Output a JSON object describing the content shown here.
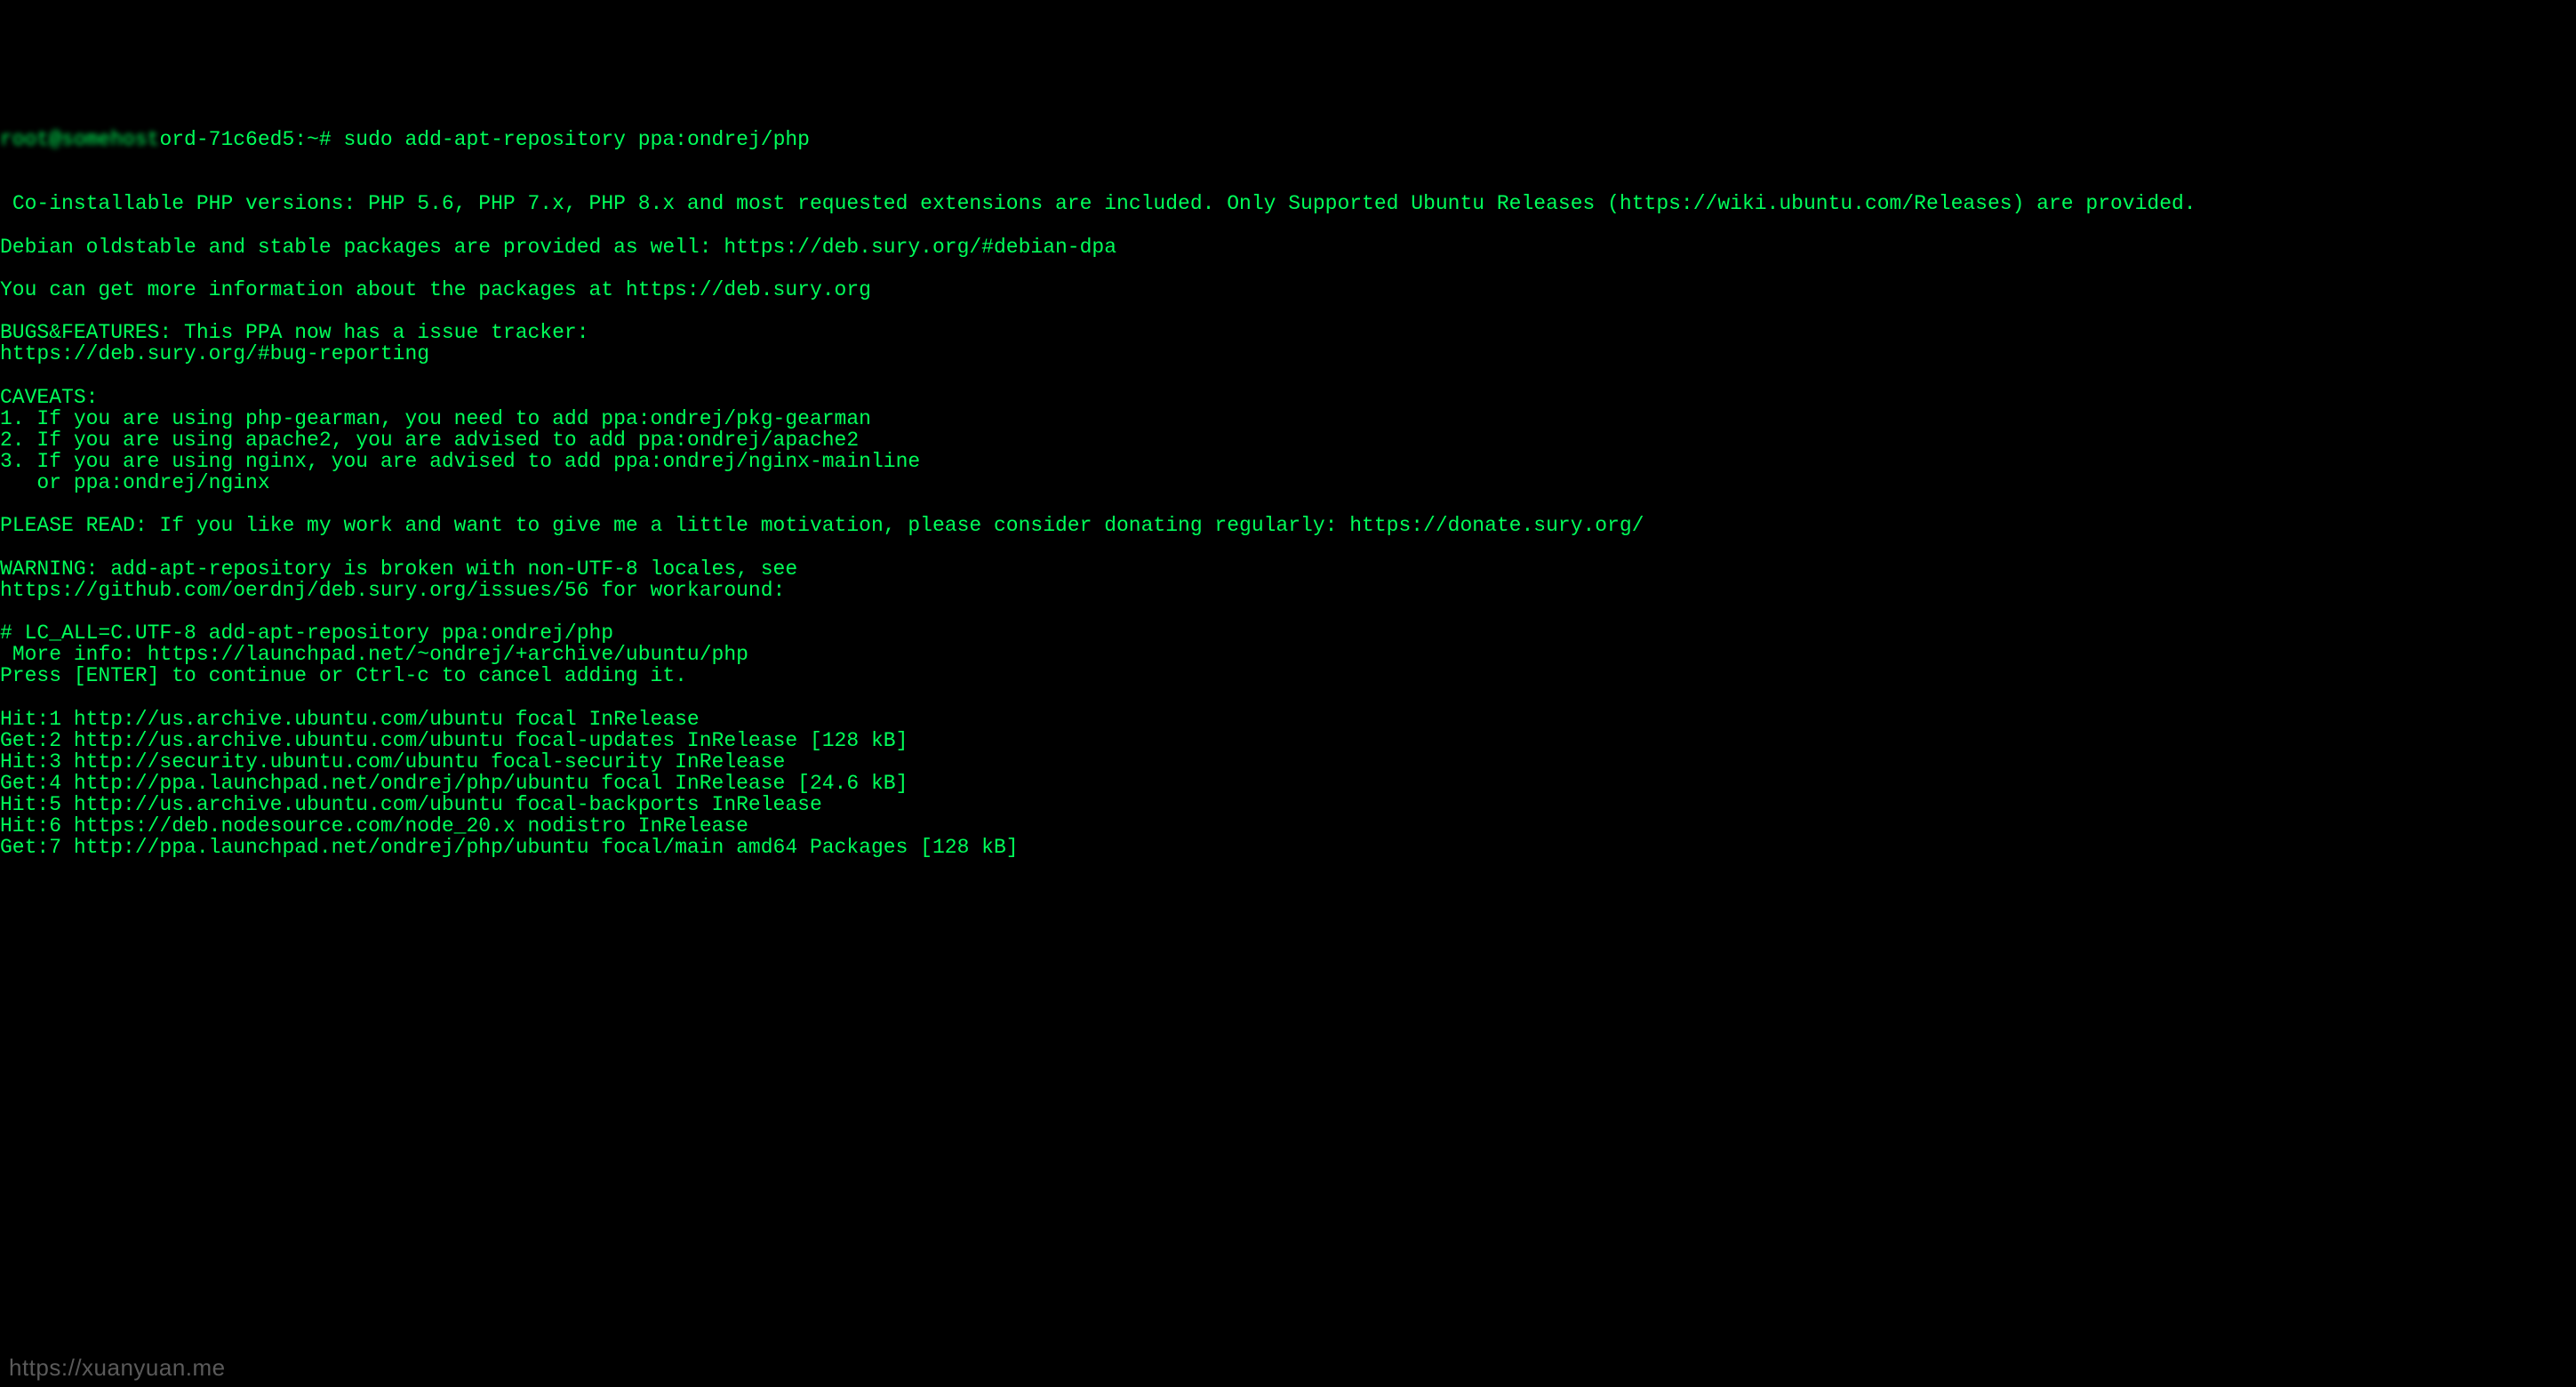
{
  "terminal": {
    "prompt_user_host_blur": "root@somehost",
    "prompt_suffix": "ord-71c6ed5:~# ",
    "command": "sudo add-apt-repository ppa:ondrej/php",
    "output_lines": [
      " Co-installable PHP versions: PHP 5.6, PHP 7.x, PHP 8.x and most requested extensions are included. Only Supported Ubuntu Releases (https://wiki.ubuntu.com/Releases) are provided.",
      "",
      "Debian oldstable and stable packages are provided as well: https://deb.sury.org/#debian-dpa",
      "",
      "You can get more information about the packages at https://deb.sury.org",
      "",
      "BUGS&FEATURES: This PPA now has a issue tracker:",
      "https://deb.sury.org/#bug-reporting",
      "",
      "CAVEATS:",
      "1. If you are using php-gearman, you need to add ppa:ondrej/pkg-gearman",
      "2. If you are using apache2, you are advised to add ppa:ondrej/apache2",
      "3. If you are using nginx, you are advised to add ppa:ondrej/nginx-mainline",
      "   or ppa:ondrej/nginx",
      "",
      "PLEASE READ: If you like my work and want to give me a little motivation, please consider donating regularly: https://donate.sury.org/",
      "",
      "WARNING: add-apt-repository is broken with non-UTF-8 locales, see",
      "https://github.com/oerdnj/deb.sury.org/issues/56 for workaround:",
      "",
      "# LC_ALL=C.UTF-8 add-apt-repository ppa:ondrej/php",
      " More info: https://launchpad.net/~ondrej/+archive/ubuntu/php",
      "Press [ENTER] to continue or Ctrl-c to cancel adding it.",
      "",
      "Hit:1 http://us.archive.ubuntu.com/ubuntu focal InRelease",
      "Get:2 http://us.archive.ubuntu.com/ubuntu focal-updates InRelease [128 kB]",
      "Hit:3 http://security.ubuntu.com/ubuntu focal-security InRelease",
      "Get:4 http://ppa.launchpad.net/ondrej/php/ubuntu focal InRelease [24.6 kB]",
      "Hit:5 http://us.archive.ubuntu.com/ubuntu focal-backports InRelease",
      "Hit:6 https://deb.nodesource.com/node_20.x nodistro InRelease",
      "Get:7 http://ppa.launchpad.net/ondrej/php/ubuntu focal/main amd64 Packages [128 kB]"
    ]
  },
  "watermark": "https://xuanyuan.me"
}
